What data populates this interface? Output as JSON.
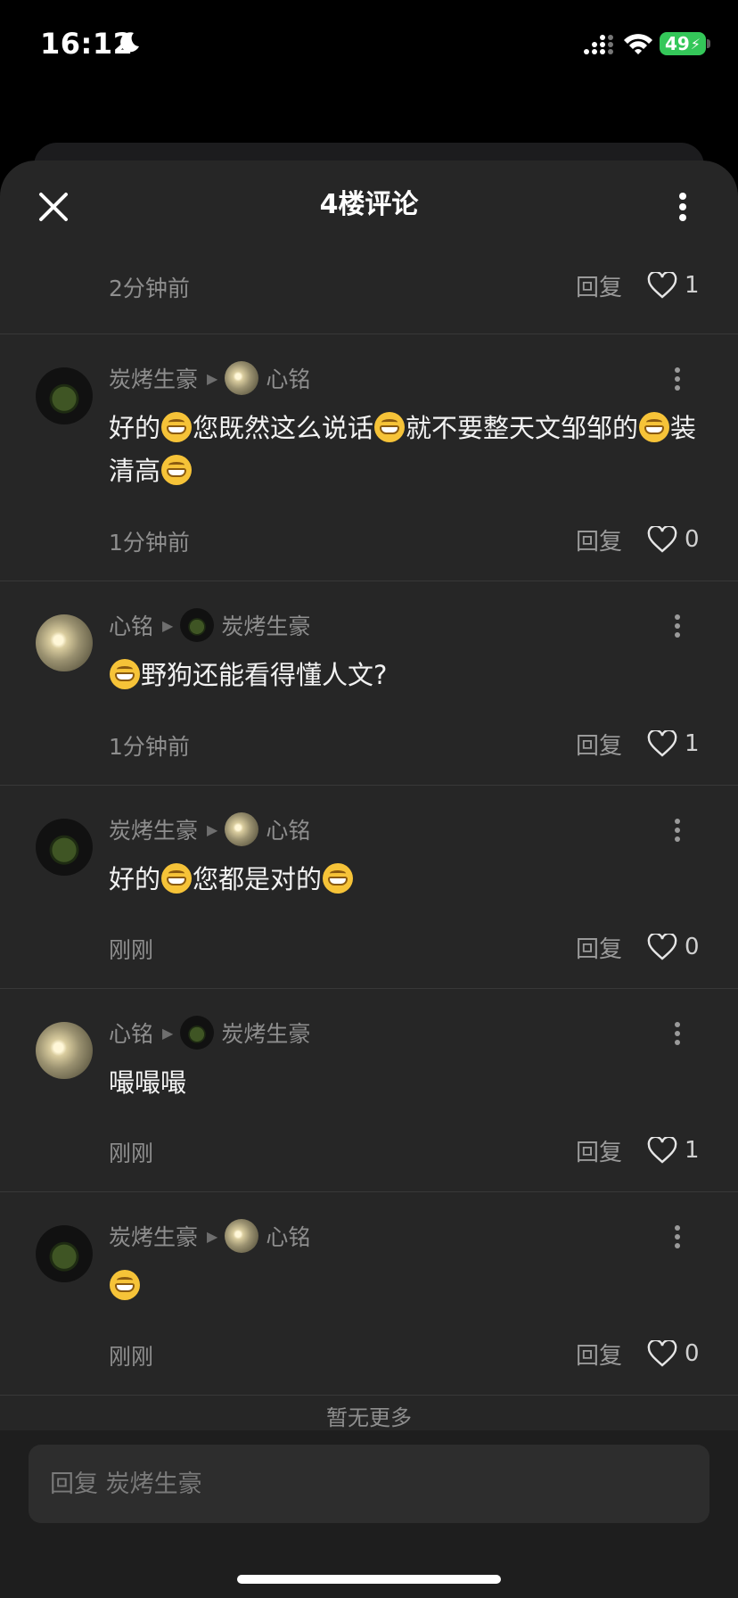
{
  "status_bar": {
    "time": "16:12",
    "battery": "49"
  },
  "sheet": {
    "title": "4楼评论"
  },
  "top_row": {
    "time": "2分钟前",
    "reply_label": "回复",
    "likes": "1"
  },
  "comments": [
    {
      "author": "炭烤生豪",
      "reply_to": "心铭",
      "author_avatar": "turtle",
      "target_avatar": "moon",
      "segments": [
        "好的",
        "grin",
        "您既然这么说话",
        "grin",
        "就不要整天文邹邹的",
        "grin",
        "装清高",
        "grin"
      ],
      "time": "1分钟前",
      "reply_label": "回复",
      "likes": "0"
    },
    {
      "author": "心铭",
      "reply_to": "炭烤生豪",
      "author_avatar": "moon",
      "target_avatar": "turtle",
      "segments": [
        "grin",
        "野狗还能看得懂人文?"
      ],
      "time": "1分钟前",
      "reply_label": "回复",
      "likes": "1"
    },
    {
      "author": "炭烤生豪",
      "reply_to": "心铭",
      "author_avatar": "turtle",
      "target_avatar": "moon",
      "segments": [
        "好的",
        "grin",
        "您都是对的",
        "grin"
      ],
      "time": "刚刚",
      "reply_label": "回复",
      "likes": "0"
    },
    {
      "author": "心铭",
      "reply_to": "炭烤生豪",
      "author_avatar": "moon",
      "target_avatar": "turtle",
      "segments": [
        "嘬嘬嘬"
      ],
      "time": "刚刚",
      "reply_label": "回复",
      "likes": "1"
    },
    {
      "author": "炭烤生豪",
      "reply_to": "心铭",
      "author_avatar": "turtle",
      "target_avatar": "moon",
      "segments": [
        "grin"
      ],
      "time": "刚刚",
      "reply_label": "回复",
      "likes": "0"
    }
  ],
  "load_more": "暂无更多",
  "input": {
    "placeholder": "回复 炭烤生豪"
  },
  "icons": {
    "close": "close-icon",
    "more": "more-vertical-icon",
    "like": "heart-outline-icon",
    "emoji": "grinning-emoji"
  }
}
